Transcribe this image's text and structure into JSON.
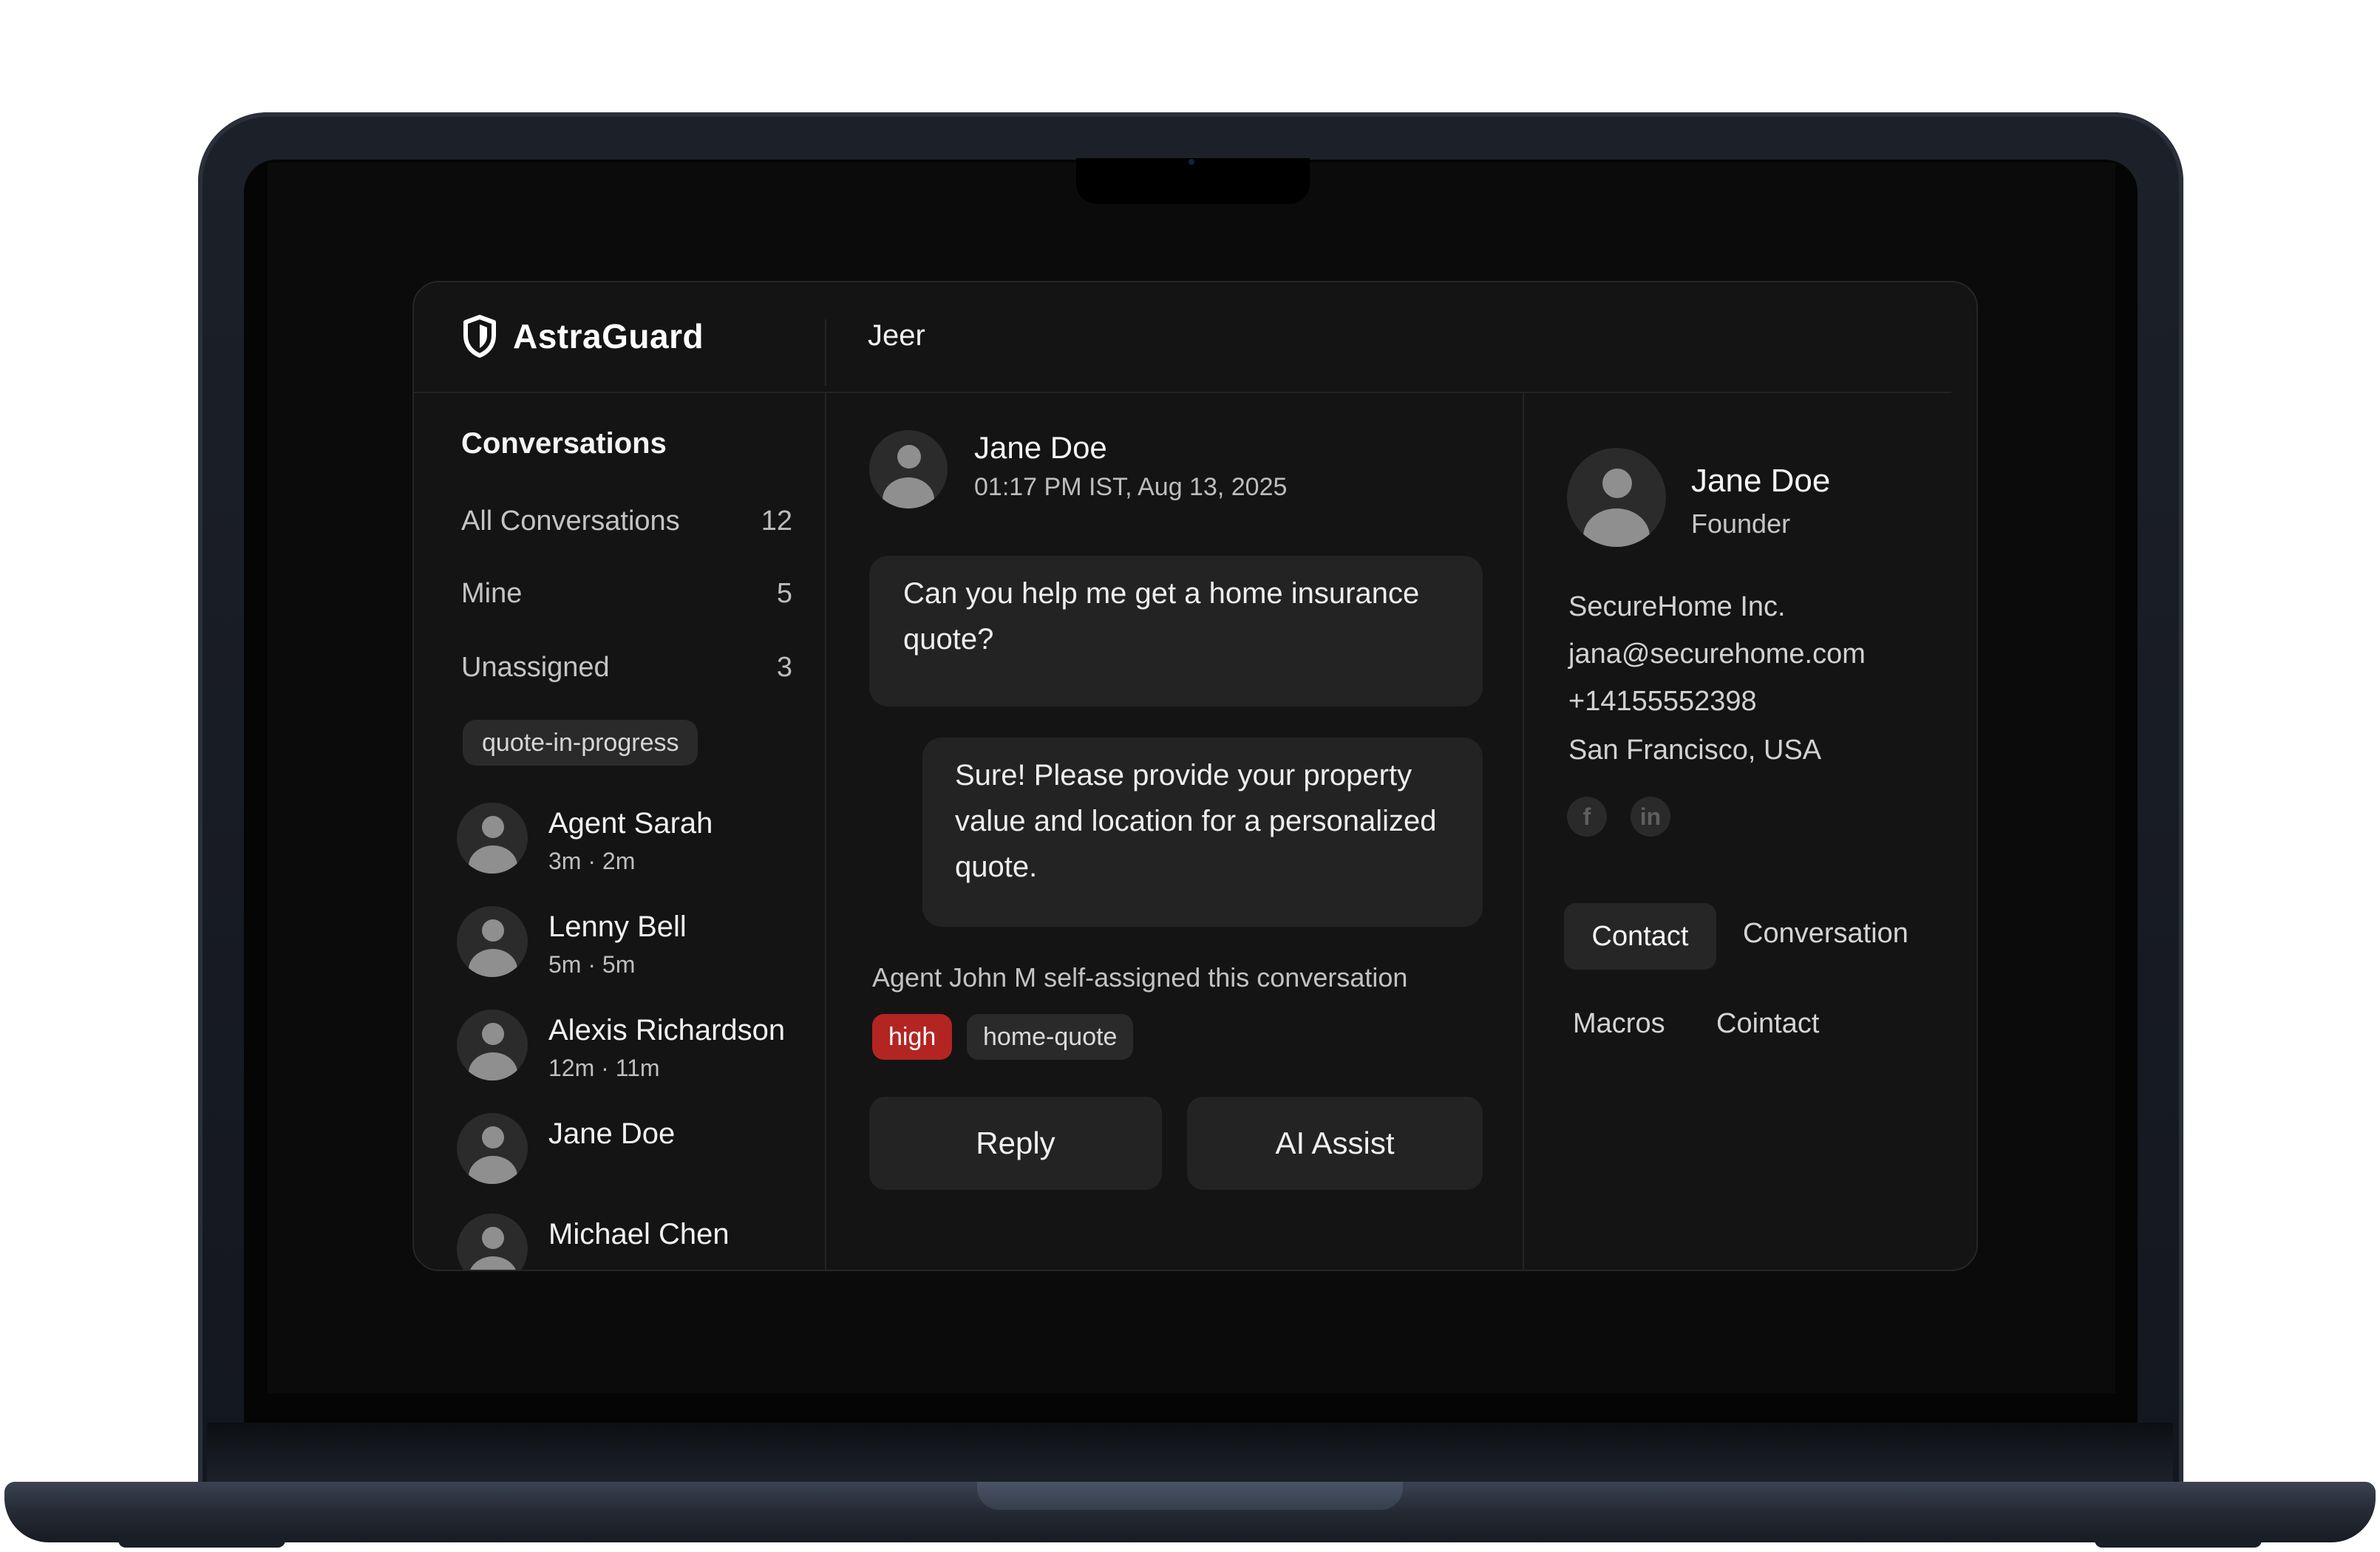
{
  "app": {
    "brand": "AstraGuard",
    "top_title": "Jeer"
  },
  "sidebar": {
    "heading": "Conversations",
    "filters": [
      {
        "label": "All Conversations",
        "count": "12"
      },
      {
        "label": "Mine",
        "count": "5"
      },
      {
        "label": "Unassigned",
        "count": "3"
      }
    ],
    "tag": "quote-in-progress",
    "agents": [
      {
        "name": "Agent Sarah",
        "time": "3m · 2m"
      },
      {
        "name": "Lenny Bell",
        "time": "5m · 5m"
      },
      {
        "name": "Alexis Richardson",
        "time": "12m · 11m"
      },
      {
        "name": "Jane Doe",
        "time": ""
      },
      {
        "name": "Michael Chen",
        "time": ""
      }
    ]
  },
  "conversation": {
    "sender": "Jane Doe",
    "timestamp": "01:17 PM IST, Aug 13, 2025",
    "messages": [
      "Can you help me get a home insurance quote?",
      "Sure! Please provide your property value and location for a personalized quote."
    ],
    "system_note": "Agent John M self-assigned this conversation",
    "tags": [
      "high",
      "home-quote"
    ],
    "actions": {
      "reply": "Reply",
      "ai_assist": "AI Assist"
    }
  },
  "contact": {
    "name": "Jane Doe",
    "role": "Founder",
    "company": "SecureHome Inc.",
    "email": "jana@securehome.com",
    "phone": "+14155552398",
    "location": "San Francisco, USA",
    "social_icons": [
      "facebook-icon",
      "linkedin-icon"
    ],
    "tabs": [
      "Contact",
      "Conversation",
      "Macros",
      "Cointact"
    ]
  },
  "colors": {
    "priority_high": "#b32522",
    "panel": "#141414",
    "surface": "#232323"
  }
}
